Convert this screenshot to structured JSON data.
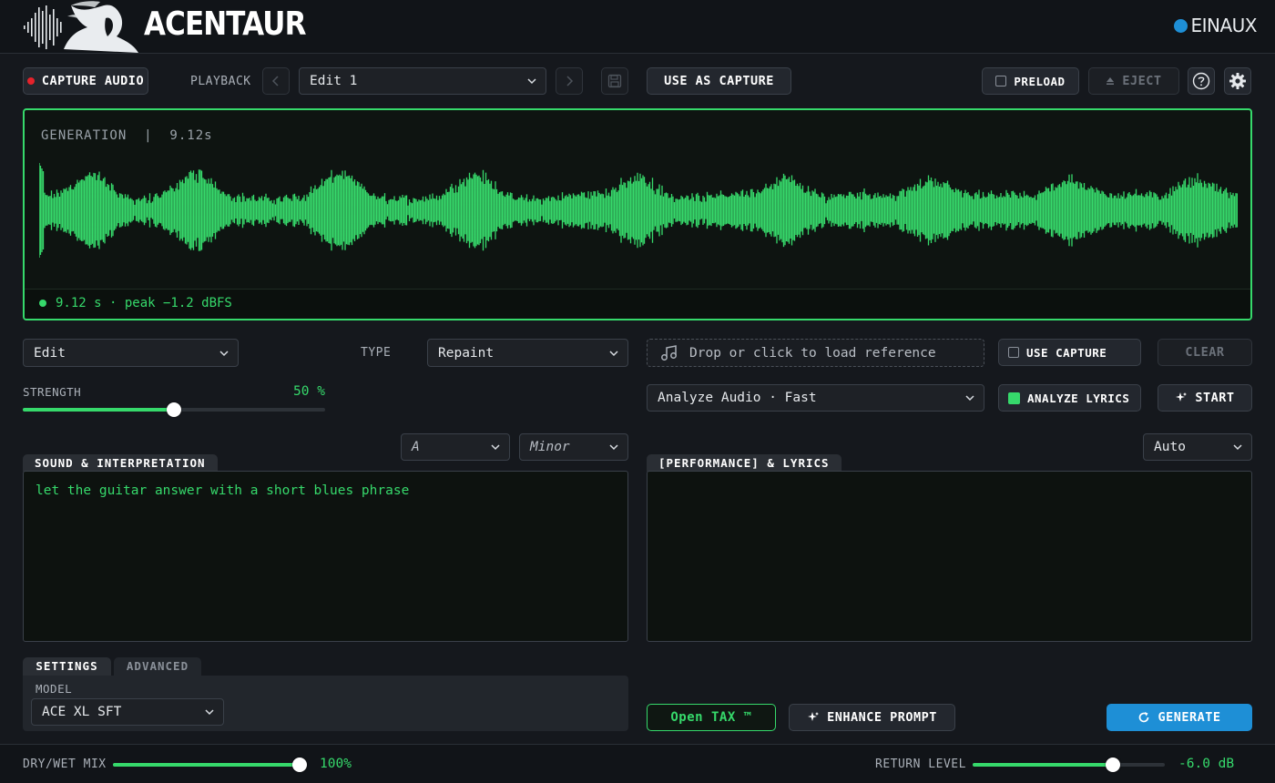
{
  "header": {
    "brand": "ACENTAUR",
    "company": "EINAUX"
  },
  "toolbar": {
    "capture_audio": "CAPTURE AUDIO",
    "playback_label": "PLAYBACK",
    "edit_select": "Edit 1",
    "use_as_capture": "USE AS CAPTURE",
    "preload": "PRELOAD",
    "eject": "EJECT"
  },
  "waveform": {
    "title": "GENERATION  |  9.12s",
    "footer": "9.12 s · peak −1.2 dBFS",
    "color": "#36d96b"
  },
  "left": {
    "mode_select": "Edit",
    "type_label": "TYPE",
    "type_select": "Repaint",
    "strength_label": "STRENGTH",
    "strength_value": "50 %",
    "strength_fraction": 0.5,
    "key_select": "A",
    "scale_select": "Minor",
    "sound_tab": "SOUND & INTERPRETATION",
    "sound_text": "let the guitar answer with a short blues phrase",
    "tabs": {
      "settings": "SETTINGS",
      "advanced": "ADVANCED"
    },
    "model_label": "MODEL",
    "model_select": "ACE XL SFT"
  },
  "right": {
    "reference_placeholder": "Drop or click to load reference",
    "use_capture": "USE CAPTURE",
    "clear": "CLEAR",
    "analyze_select": "Analyze Audio · Fast",
    "analyze_lyrics": "ANALYZE LYRICS",
    "start": "START",
    "lang_select": "Auto",
    "lyrics_tab": "[PERFORMANCE] & LYRICS",
    "lyrics_text": "",
    "open_tax": "Open TAX ™",
    "enhance": "ENHANCE PROMPT",
    "generate": "GENERATE"
  },
  "bottom": {
    "drywet_label": "DRY/WET MIX",
    "drywet_value": "100%",
    "drywet_fraction": 1.0,
    "return_label": "RETURN LEVEL",
    "return_value": "-6.0 dB",
    "return_fraction": 0.73
  },
  "colors": {
    "accent": "#36d96b",
    "generate": "#1e8fd6",
    "record": "#e5222b"
  }
}
